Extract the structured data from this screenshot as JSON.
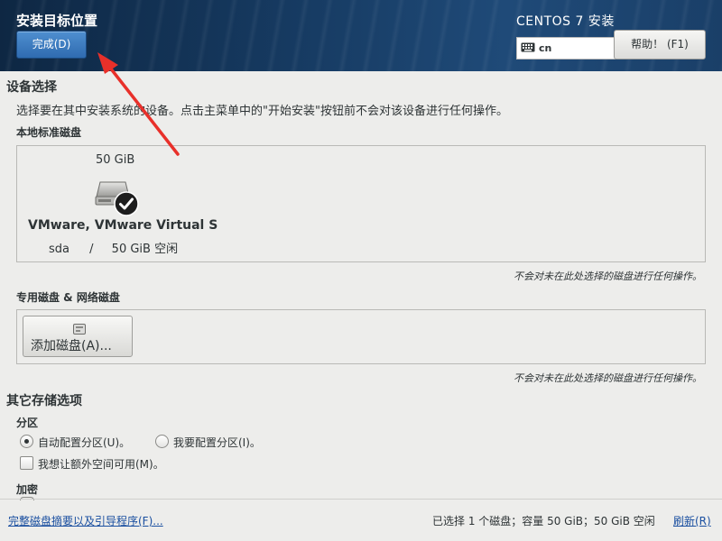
{
  "header": {
    "title": "安装目标位置",
    "done_label": "完成(D)",
    "product": "CENTOS 7 安装",
    "keyboard_layout": "cn",
    "help_label": "帮助！ (F1)"
  },
  "device_selection": {
    "heading": "设备选择",
    "description": "选择要在其中安装系统的设备。点击主菜单中的\"开始安装\"按钮前不会对该设备进行任何操作。",
    "local_disks_heading": "本地标准磁盘",
    "disk": {
      "size": "50 GiB",
      "name": "VMware, VMware Virtual S",
      "device": "sda",
      "separator": "/",
      "free": "50 GiB 空闲",
      "icon": "hard-disk-icon",
      "selected_icon": "checkmark-icon"
    },
    "local_note": "不会对未在此处选择的磁盘进行任何操作。",
    "specialized_heading": "专用磁盘 & 网络磁盘",
    "add_disk_label": "添加磁盘(A)...",
    "specialized_note": "不会对未在此处选择的磁盘进行任何操作。"
  },
  "other_storage": {
    "heading": "其它存储选项",
    "partitioning_heading": "分区",
    "auto_partition_label": "自动配置分区(U)。",
    "manual_partition_label": "我要配置分区(I)。",
    "extra_space_label": "我想让额外空间可用(M)。",
    "encryption_heading": "加密"
  },
  "footer": {
    "summary_link": "完整磁盘摘要以及引导程序(F)...",
    "status": "已选择 1 个磁盘；容量 50 GiB；50 GiB 空闲",
    "refresh_link": "刷新(R)"
  },
  "colors": {
    "header_bg": "#163a61",
    "accent_button": "#3a7bc0",
    "link": "#1a4fa0",
    "annotation_arrow": "#e8302a"
  }
}
